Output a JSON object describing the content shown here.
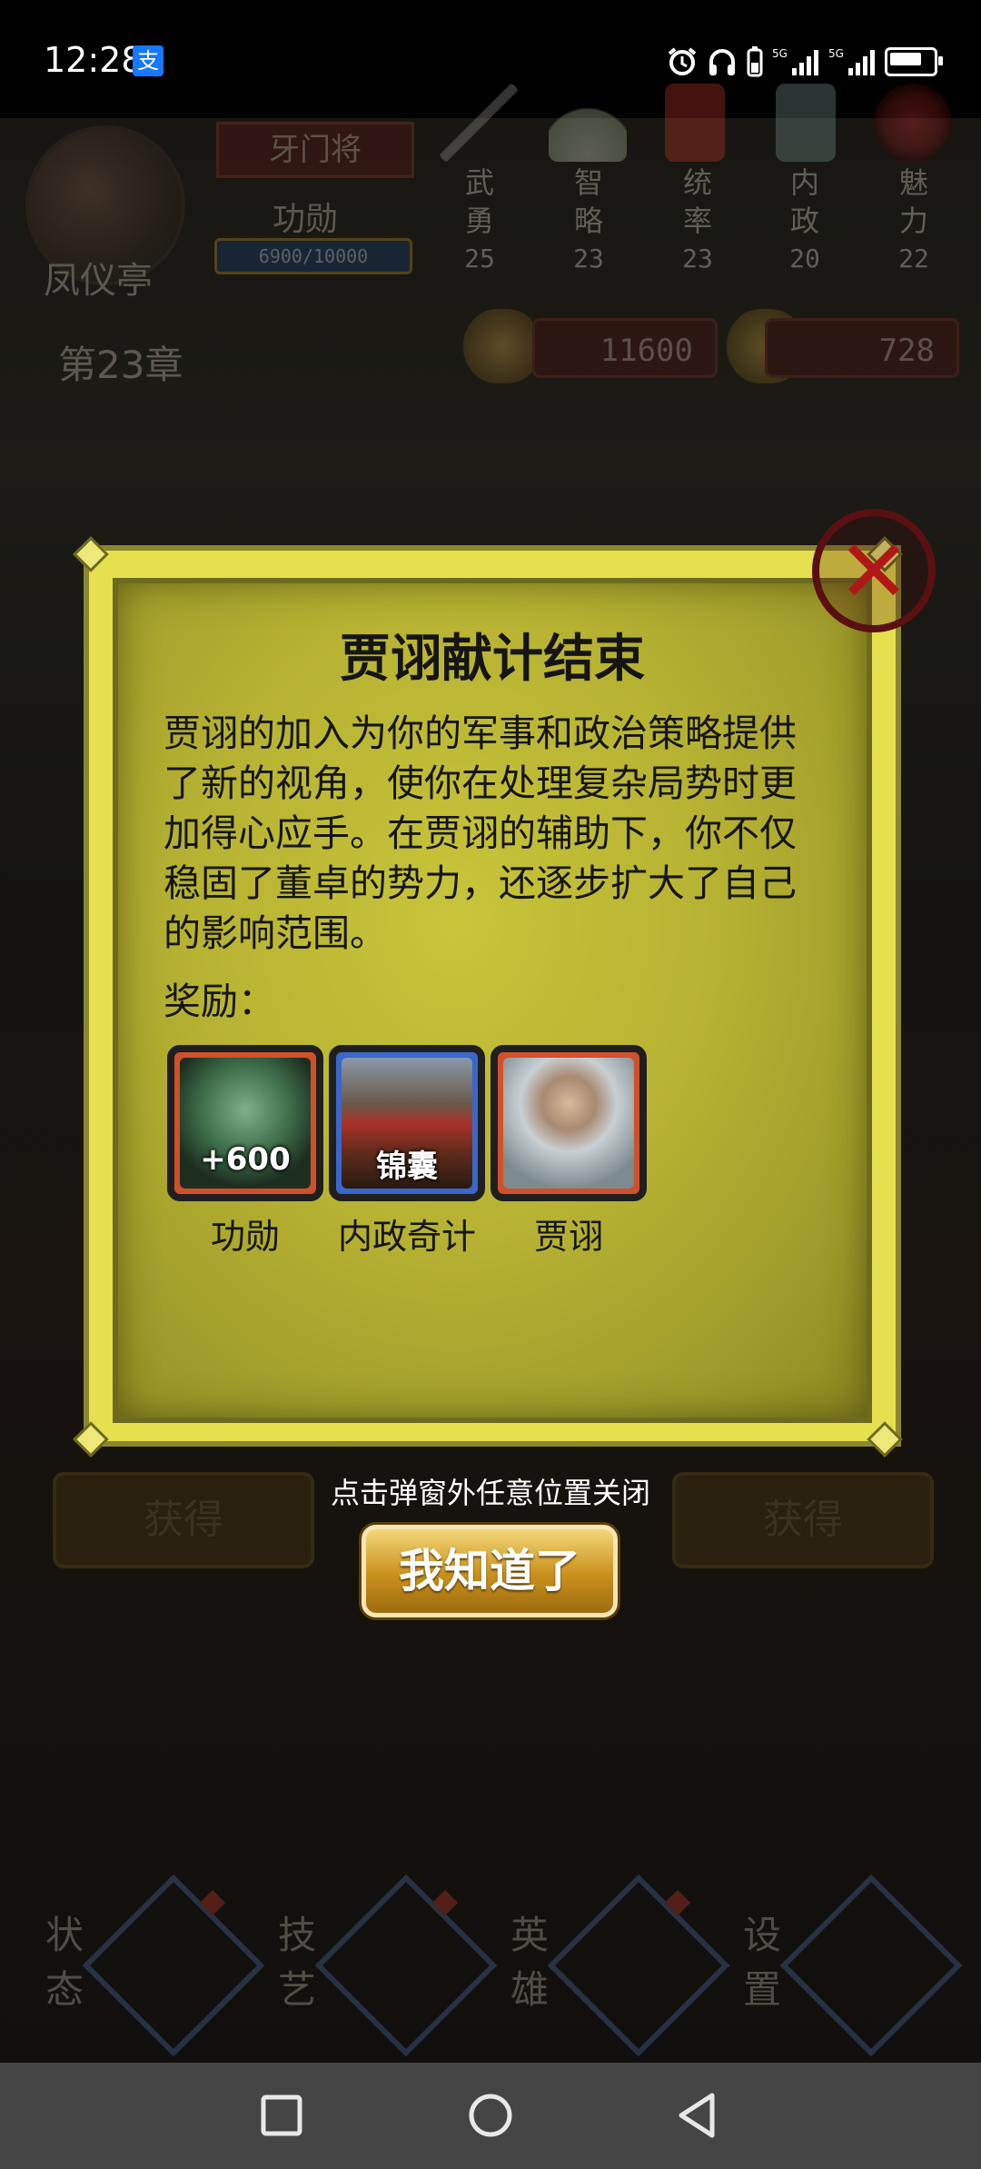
{
  "status_bar": {
    "time": "12:28",
    "pay_icon_char": "支",
    "icons": [
      "alarm-icon",
      "headphones-icon",
      "battery-saver-icon",
      "signal-5g-icon",
      "signal-5g-icon",
      "battery-icon"
    ]
  },
  "game": {
    "player_name": "凤仪亭",
    "rank": "牙门将",
    "merit_label": "功勋",
    "merit_progress": "6900/10000",
    "stats": [
      {
        "label_1": "武",
        "label_2": "勇",
        "value": "25",
        "icon": "spear-icon"
      },
      {
        "label_1": "智",
        "label_2": "略",
        "value": "23",
        "icon": "fan-icon"
      },
      {
        "label_1": "统",
        "label_2": "率",
        "value": "23",
        "icon": "command-token-icon"
      },
      {
        "label_1": "内",
        "label_2": "政",
        "value": "20",
        "icon": "seal-icon"
      },
      {
        "label_1": "魅",
        "label_2": "力",
        "value": "22",
        "icon": "medallion-icon"
      }
    ],
    "chapter": "第23章",
    "resources": {
      "coins": "11600",
      "grain": "728"
    },
    "obtain_left": "获得",
    "obtain_right": "获得",
    "bottom_nav": [
      {
        "label_1": "状",
        "label_2": "态",
        "icon": "dragon-emblem-icon"
      },
      {
        "label_1": "技",
        "label_2": "艺",
        "icon": "leaf-icon"
      },
      {
        "label_1": "英",
        "label_2": "雄",
        "icon": "helmet-icon"
      },
      {
        "label_1": "设",
        "label_2": "置",
        "icon": "gear-icon"
      }
    ]
  },
  "dialog": {
    "title": "贾诩献计结束",
    "body": "贾诩的加入为你的军事和政治策略提供了新的视角，使你在处理复杂局势时更加得心应手。在贾诩的辅助下，你不仅稳固了董卓的势力，还逐步扩大了自己的影响范围。",
    "reward_label": "奖励：",
    "rewards": [
      {
        "name": "功勋",
        "overlay": "+600",
        "frame_color": "#d0502a",
        "icon": "jade-merit-icon"
      },
      {
        "name": "内政奇计",
        "overlay": "锦囊",
        "frame_color": "#3a67c9",
        "icon": "palace-icon"
      },
      {
        "name": "贾诩",
        "overlay": "",
        "frame_color": "#d0502a",
        "icon": "jia-xu-portrait"
      }
    ],
    "close_hint": "点击弹窗外任意位置关闭",
    "confirm_label": "我知道了"
  },
  "nav_bar": [
    "recents-icon",
    "home-icon",
    "back-icon"
  ]
}
